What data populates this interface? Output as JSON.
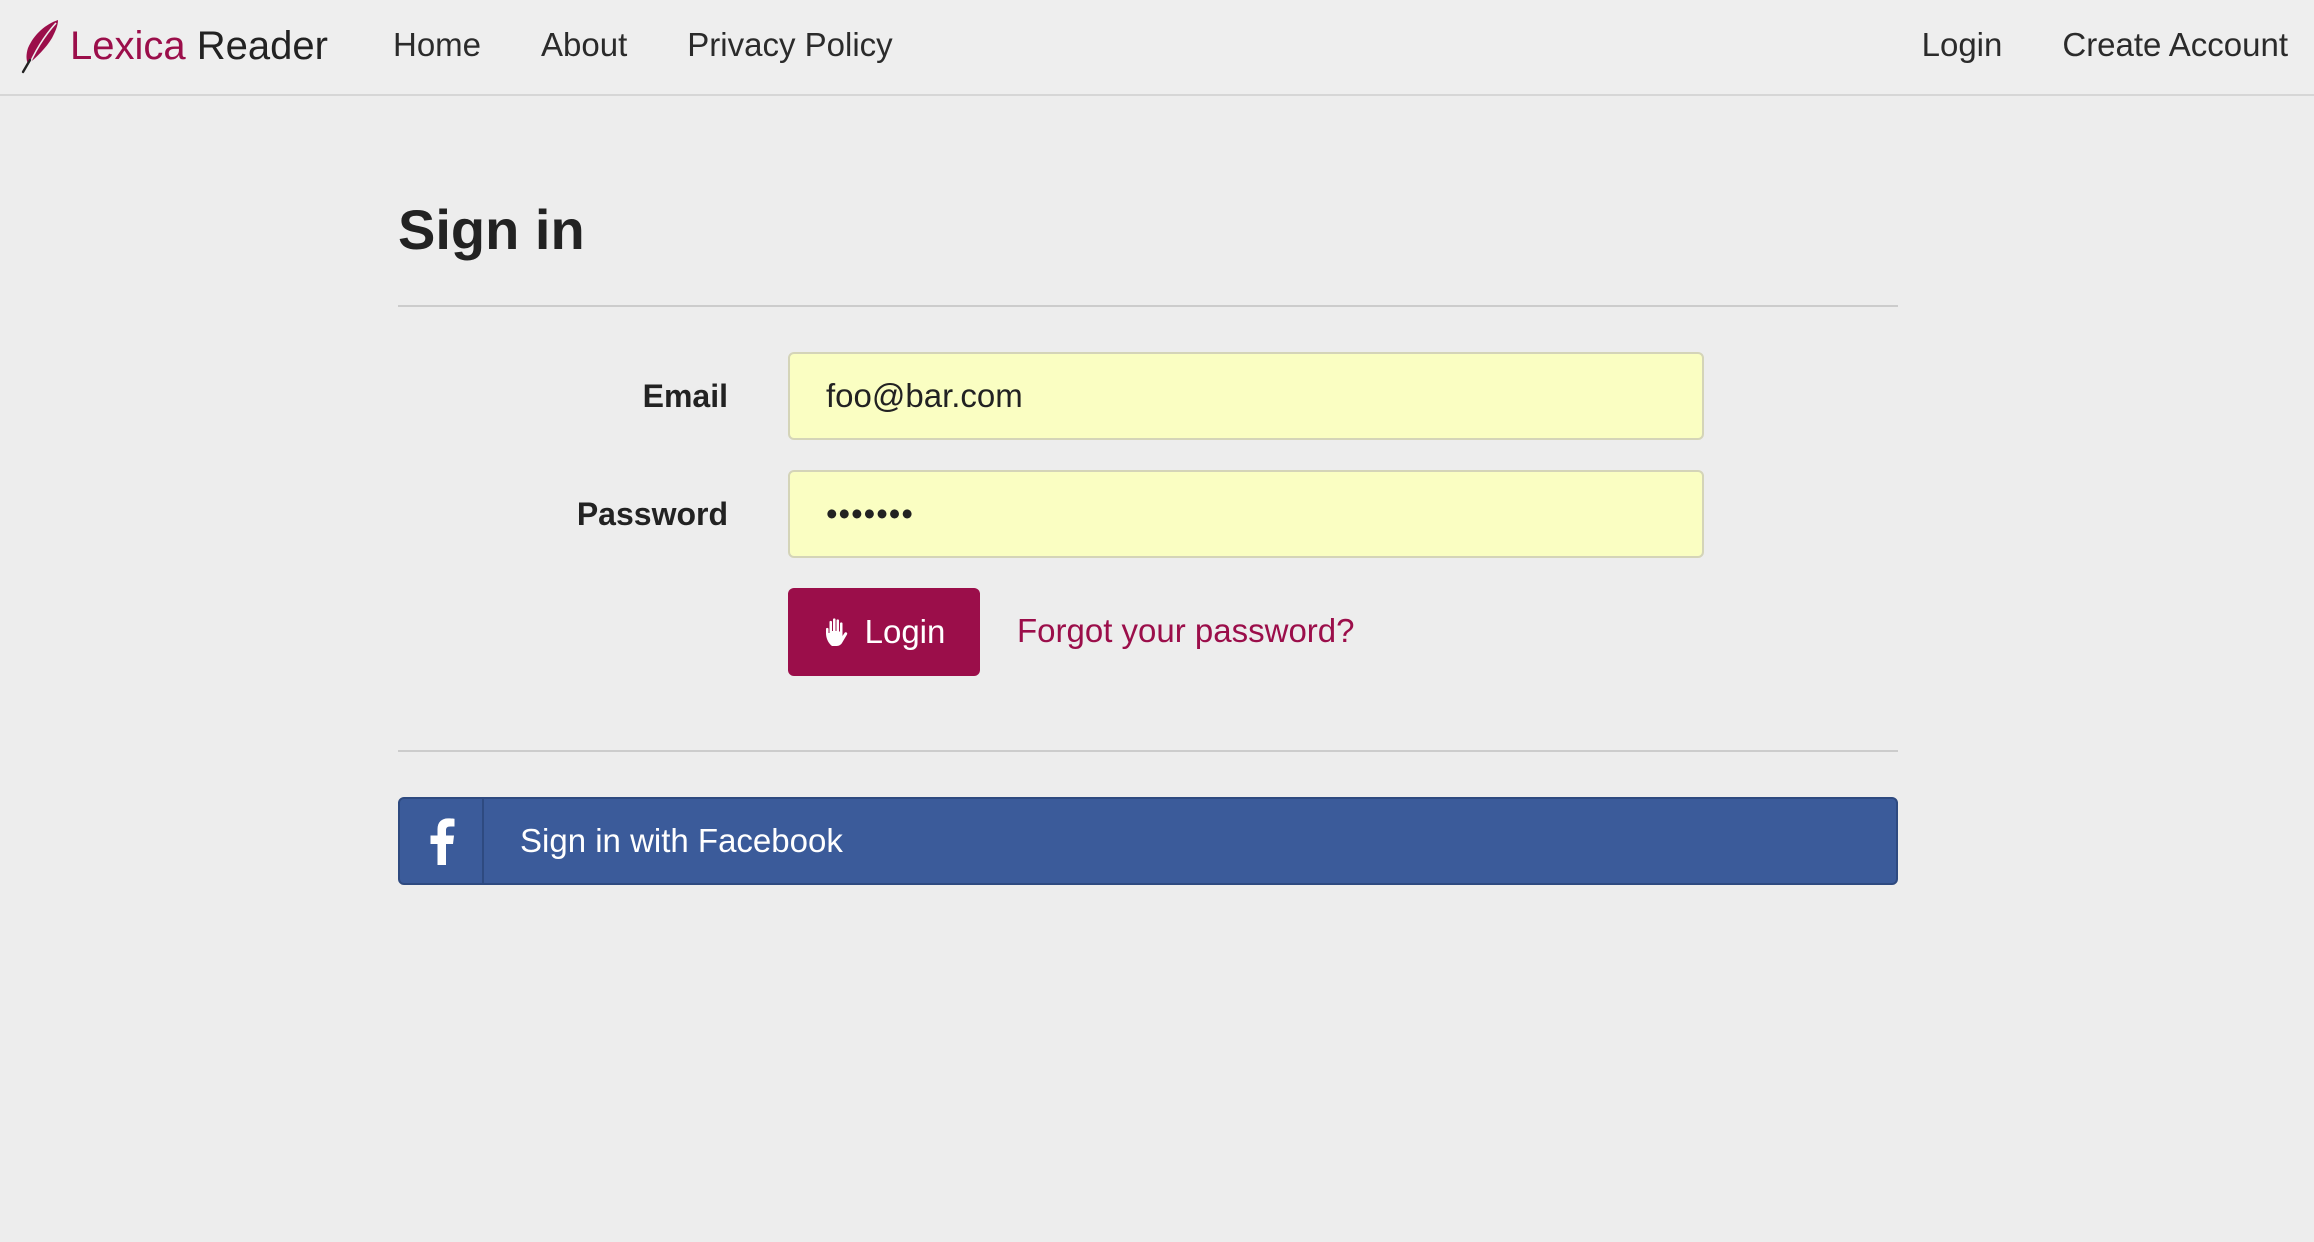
{
  "brand": {
    "name_part1": "Lexica",
    "name_part2": "Reader",
    "logo_icon": "quill-feather-icon",
    "accent_color": "#9b0e4a"
  },
  "nav": {
    "left": [
      {
        "label": "Home"
      },
      {
        "label": "About"
      },
      {
        "label": "Privacy Policy"
      }
    ],
    "right": [
      {
        "label": "Login"
      },
      {
        "label": "Create Account"
      }
    ]
  },
  "page": {
    "title": "Sign in"
  },
  "form": {
    "email_label": "Email",
    "email_value": "foo@bar.com",
    "password_label": "Password",
    "password_value": "•••••••",
    "input_background": "#fafec2",
    "login_button_label": "Login",
    "login_button_icon": "hand-icon",
    "forgot_password_link": "Forgot your password?"
  },
  "social": {
    "facebook_label": "Sign in with Facebook",
    "facebook_icon": "facebook-icon",
    "facebook_color": "#3b5b9a"
  }
}
